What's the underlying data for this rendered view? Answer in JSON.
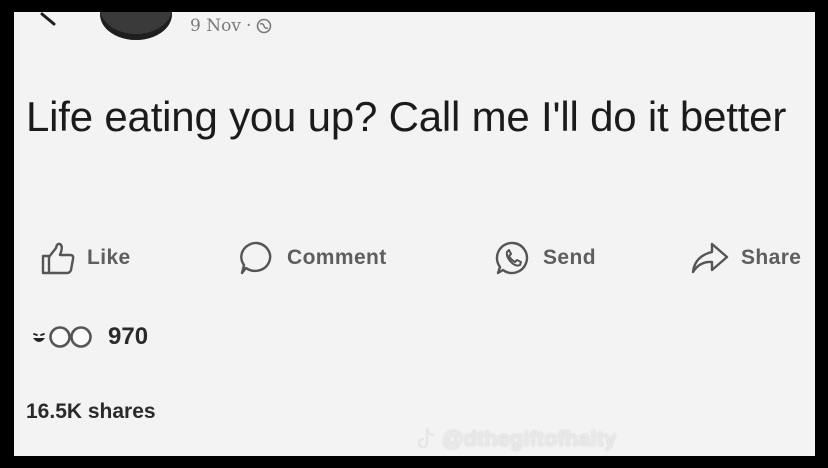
{
  "post": {
    "date": "9 Nov",
    "separator": "·",
    "text": "Life eating you up? Call me I'll do it better"
  },
  "actions": {
    "like": "Like",
    "comment": "Comment",
    "send": "Send",
    "share": "Share"
  },
  "engagement": {
    "reactions_count": "970",
    "shares": "16.5K shares"
  },
  "icons": {
    "back": "back-arrow-icon",
    "privacy": "globe-icon",
    "like": "thumbs-up-icon",
    "comment": "speech-bubble-icon",
    "send": "whatsapp-icon",
    "share": "share-arrow-icon",
    "reactions": [
      "laugh-emoji-icon",
      "love-reaction-icon",
      "like-reaction-icon"
    ],
    "watermark": "tiktok-icon"
  },
  "watermark": {
    "handle": "@dthegiftofhalty"
  }
}
